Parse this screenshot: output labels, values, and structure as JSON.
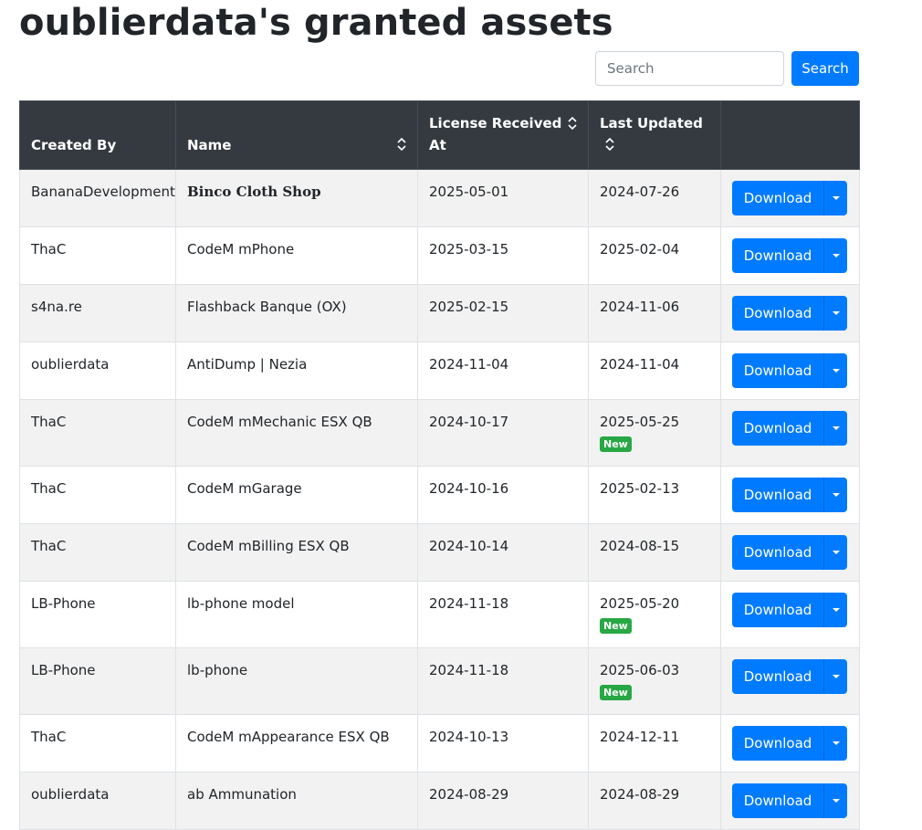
{
  "page": {
    "title": "oublierdata's granted assets"
  },
  "search": {
    "placeholder": "Search",
    "value": "",
    "button_label": "Search"
  },
  "table": {
    "headers": {
      "created_by": "Created By",
      "name": "Name",
      "license_received": "License Received At",
      "last_updated": "Last Updated",
      "actions": ""
    },
    "rows": [
      {
        "created_by": "BananaDevelopment",
        "name": "Binco Cloth Shop",
        "license": "2025-05-01",
        "updated": "2024-07-26",
        "new": "",
        "download": "Download"
      },
      {
        "created_by": "ThaC",
        "name": "CodeM mPhone",
        "license": "2025-03-15",
        "updated": "2025-02-04",
        "new": "",
        "download": "Download"
      },
      {
        "created_by": "s4na.re",
        "name": "Flashback Banque (OX)",
        "license": "2025-02-15",
        "updated": "2024-11-06",
        "new": "",
        "download": "Download"
      },
      {
        "created_by": "oublierdata",
        "name": "AntiDump | Nezia",
        "license": "2024-11-04",
        "updated": "2024-11-04",
        "new": "",
        "download": "Download"
      },
      {
        "created_by": "ThaC",
        "name": "CodeM mMechanic ESX QB",
        "license": "2024-10-17",
        "updated": "2025-05-25",
        "new": "New",
        "download": "Download"
      },
      {
        "created_by": "ThaC",
        "name": "CodeM mGarage",
        "license": "2024-10-16",
        "updated": "2025-02-13",
        "new": "",
        "download": "Download"
      },
      {
        "created_by": "ThaC",
        "name": "CodeM mBilling ESX QB",
        "license": "2024-10-14",
        "updated": "2024-08-15",
        "new": "",
        "download": "Download"
      },
      {
        "created_by": "LB-Phone",
        "name": "lb-phone model",
        "license": "2024-11-18",
        "updated": "2025-05-20",
        "new": "New",
        "download": "Download"
      },
      {
        "created_by": "LB-Phone",
        "name": "lb-phone",
        "license": "2024-11-18",
        "updated": "2025-06-03",
        "new": "New",
        "download": "Download"
      },
      {
        "created_by": "ThaC",
        "name": "CodeM mAppearance ESX QB",
        "license": "2024-10-13",
        "updated": "2024-12-11",
        "new": "",
        "download": "Download"
      },
      {
        "created_by": "oublierdata",
        "name": "ab Ammunation",
        "license": "2024-08-29",
        "updated": "2024-08-29",
        "new": "",
        "download": "Download"
      }
    ]
  },
  "colors": {
    "primary": "#007bff",
    "header_bg": "#343a40",
    "new_badge": "#28a745",
    "stripe": "#f2f2f2"
  }
}
